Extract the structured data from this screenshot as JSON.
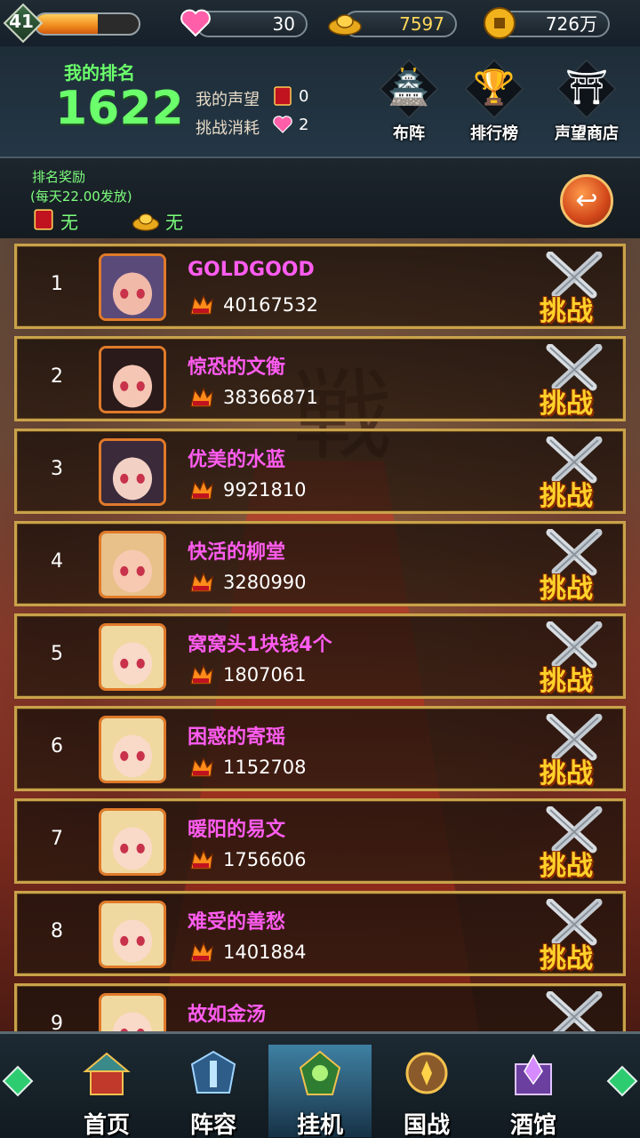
{
  "topbar": {
    "level": "41",
    "exp_progress": 0.6,
    "hearts": "30",
    "gold_ingots": "7597",
    "coins": "726万"
  },
  "header": {
    "my_rank_label": "我的排名",
    "my_rank_value": "1622",
    "prestige_label": "我的声望",
    "prestige_value": "0",
    "challenge_cost_label": "挑战消耗",
    "challenge_cost_value": "2",
    "buttons": [
      {
        "label": "布阵",
        "icon": "formation-icon"
      },
      {
        "label": "排行榜",
        "icon": "trophy-icon"
      },
      {
        "label": "声望商店",
        "icon": "shop-icon"
      }
    ]
  },
  "reward": {
    "title": "排名奖励",
    "subtitle": "(每天22.00发放)",
    "prestige_reward": "无",
    "ingot_reward": "无"
  },
  "challenge_label": "挑战",
  "players": [
    {
      "rank": "1",
      "name": "GOLDGOOD",
      "power": "40167532"
    },
    {
      "rank": "2",
      "name": "惊恐的文衡",
      "power": "38366871"
    },
    {
      "rank": "3",
      "name": "优美的水蓝",
      "power": "9921810"
    },
    {
      "rank": "4",
      "name": "快活的柳堂",
      "power": "3280990"
    },
    {
      "rank": "5",
      "name": "窝窝头1块钱4个",
      "power": "1807061"
    },
    {
      "rank": "6",
      "name": "困惑的寄瑶",
      "power": "1152708"
    },
    {
      "rank": "7",
      "name": "暖阳的易文",
      "power": "1756606"
    },
    {
      "rank": "8",
      "name": "难受的善愁",
      "power": "1401884"
    },
    {
      "rank": "9",
      "name": "故如金汤",
      "power": ""
    }
  ],
  "nav": [
    {
      "label": "首页",
      "icon": "home-icon"
    },
    {
      "label": "阵容",
      "icon": "lineup-icon"
    },
    {
      "label": "挂机",
      "icon": "idle-icon"
    },
    {
      "label": "国战",
      "icon": "war-icon"
    },
    {
      "label": "酒馆",
      "icon": "tavern-icon"
    }
  ],
  "colors": {
    "accent_green": "#6bff6b",
    "name_magenta": "#ff5cf0",
    "gold_border": "#c9a24a",
    "fight_yellow": "#ffd22a"
  }
}
